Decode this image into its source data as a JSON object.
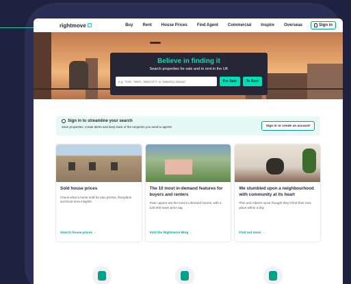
{
  "header": {
    "logo": "rightmove",
    "nav": [
      "Buy",
      "Rent",
      "House Prices",
      "Find Agent",
      "Commercial",
      "Inspire",
      "Overseas"
    ],
    "signin_label": "Sign in"
  },
  "hero": {
    "title": "Believe in finding it",
    "subtitle": "Search properties for sale and to rent in the UK",
    "search_placeholder": "e.g. 'York', 'NW3', 'NW3 5TY' or 'Waterloo Station'",
    "for_sale_label": "For Sale",
    "to_rent_label": "To Rent"
  },
  "banner": {
    "title": "Sign in to streamline your search",
    "subtitle": "Save properties, create alerts and keep track of the enquiries you send to agents.",
    "button": "Sign in or create an account"
  },
  "cards": [
    {
      "title": "Sold house prices",
      "text": "Check what a home sold for plus photos, floorplans and local area insights.",
      "link": "Search house prices →"
    },
    {
      "title": "The 10 most in-demand features for buyers and renters",
      "text": "Fixer uppers are the most in-demand homes, with a £25,000 lower price tag.",
      "link": "Visit the Rightmove Blog →"
    },
    {
      "title": "We stumbled upon a neighbourhood with community at its heart",
      "text": "Phin and Alberte never thought they'd find their new place within a day.",
      "link": "Find out more →"
    }
  ],
  "colors": {
    "brand_green": "#00deb6",
    "dark_navy": "#262637",
    "background": "#1f2140"
  }
}
